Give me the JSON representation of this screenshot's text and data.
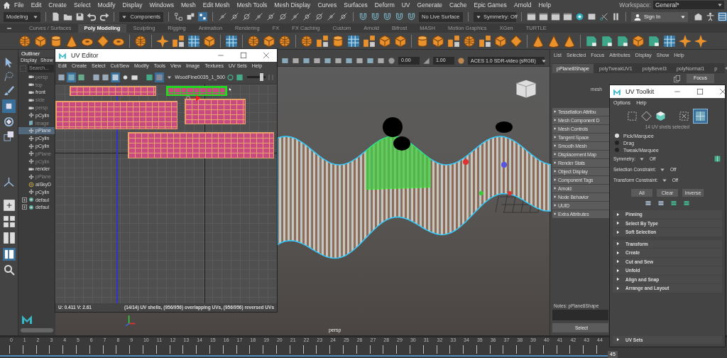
{
  "menu_bar": {
    "items": [
      "File",
      "Edit",
      "Create",
      "Select",
      "Modify",
      "Display",
      "Windows",
      "Mesh",
      "Edit Mesh",
      "Mesh Tools",
      "Mesh Display",
      "Curves",
      "Surfaces",
      "Deform",
      "UV",
      "Generate",
      "Cache",
      "Epic Games",
      "Arnold",
      "Help"
    ],
    "workspace_label": "Workspace:",
    "workspace_value": "General*"
  },
  "status_line": {
    "menu_set": "Modeling",
    "selection_mode": "Components",
    "live_surface": "No Live Surface",
    "symmetry": "Symmetry: Off",
    "sign_in": "Sign In"
  },
  "shelf": {
    "tabs": [
      {
        "label": "Curves / Surfaces",
        "selected": false
      },
      {
        "label": "Poly Modeling",
        "selected": true
      },
      {
        "label": "Sculpting",
        "selected": false
      },
      {
        "label": "Rigging",
        "selected": false
      },
      {
        "label": "Animation",
        "selected": false
      },
      {
        "label": "Rendering",
        "selected": false
      },
      {
        "label": "FX",
        "selected": false
      },
      {
        "label": "FX Caching",
        "selected": false
      },
      {
        "label": "Custom",
        "selected": false
      },
      {
        "label": "Arnold",
        "selected": false
      },
      {
        "label": "Bifrost",
        "selected": false
      },
      {
        "label": "MASH",
        "selected": false
      },
      {
        "label": "Motion Graphics",
        "selected": false
      },
      {
        "label": "XGen",
        "selected": false
      },
      {
        "label": "TURTLE",
        "selected": false
      }
    ]
  },
  "outliner": {
    "title": "Outliner",
    "menu": [
      "Display",
      "Show"
    ],
    "search_placeholder": "Search...",
    "items": [
      {
        "label": "persp",
        "kind": "camera",
        "dim": true,
        "selected": false
      },
      {
        "label": "top",
        "kind": "camera",
        "dim": true,
        "selected": false
      },
      {
        "label": "front",
        "kind": "camera",
        "dim": false,
        "selected": false
      },
      {
        "label": "side",
        "kind": "camera",
        "dim": true,
        "selected": false
      },
      {
        "label": "persp",
        "kind": "camera",
        "dim": true,
        "selected": false
      },
      {
        "label": "pCylin",
        "kind": "mesh",
        "dim": false,
        "selected": false
      },
      {
        "label": "image",
        "kind": "image",
        "dim": true,
        "selected": false
      },
      {
        "label": "pPlane",
        "kind": "mesh",
        "dim": false,
        "selected": true
      },
      {
        "label": "pCylin",
        "kind": "mesh",
        "dim": false,
        "selected": false
      },
      {
        "label": "pCylin",
        "kind": "mesh",
        "dim": false,
        "selected": false
      },
      {
        "label": "pPlane",
        "kind": "mesh",
        "dim": true,
        "selected": false
      },
      {
        "label": "pCylin",
        "kind": "mesh",
        "dim": true,
        "selected": false
      },
      {
        "label": "render",
        "kind": "camera",
        "dim": false,
        "selected": false
      },
      {
        "label": "pPlane",
        "kind": "mesh",
        "dim": true,
        "selected": false
      },
      {
        "label": "aiSkyD",
        "kind": "light",
        "dim": false,
        "selected": false
      },
      {
        "label": "pCylin",
        "kind": "mesh",
        "dim": false,
        "selected": false
      },
      {
        "label": "defaul",
        "kind": "set",
        "dim": false,
        "selected": false
      },
      {
        "label": "defaul",
        "kind": "set",
        "dim": false,
        "selected": false
      }
    ]
  },
  "viewport": {
    "exposure": "0.00",
    "gamma": "1.00",
    "color_space": "ACES 1.0 SDR-video (sRGB)",
    "camera_label": "persp"
  },
  "uv_editor": {
    "title": "UV Editor",
    "menu": [
      "Edit",
      "Create",
      "Select",
      "Cut/Sew",
      "Modify",
      "Tools",
      "View",
      "Image",
      "Textures",
      "UV Sets",
      "Help"
    ],
    "texture": "WoodFine0035_1_500",
    "shells": [
      {
        "selected": false
      },
      {
        "selected": true
      },
      {
        "selected": false
      },
      {
        "selected": false
      },
      {
        "selected": false
      }
    ],
    "coords": "U: 0.411 V: 2.61",
    "status": "(14/14) UV shells, (956/956) overlapping UVs, (956/956) reversed UVs"
  },
  "attribute_editor": {
    "menu": [
      "List",
      "Selected",
      "Focus",
      "Attributes",
      "Display",
      "Show",
      "Help"
    ],
    "tabs": [
      {
        "label": "pPlane8Shape",
        "selected": true
      },
      {
        "label": "polyTweakUV1",
        "selected": false
      },
      {
        "label": "polyBevel3",
        "selected": false
      },
      {
        "label": "polyNormal1",
        "selected": false
      },
      {
        "label": "p",
        "selected": false
      }
    ],
    "focus_button": "Focus",
    "mesh_label": "mesh",
    "sections": [
      "Tessellation Attribu",
      "Mesh Component D",
      "Mesh Controls",
      "Tangent Space",
      "Smooth Mesh",
      "Displacement Map",
      "Render Stats",
      "Object Display",
      "Component Tags",
      "Arnold",
      "Node Behavior",
      "UUID",
      "Extra Attributes"
    ],
    "notes_label": "Notes:  pPlane8Shape",
    "select_button": "Select"
  },
  "uv_toolkit": {
    "title": "UV Toolkit",
    "menu": [
      "Options",
      "Help"
    ],
    "selection_info": "14 UV shells selected",
    "modes": [
      {
        "label": "Pick/Marquee",
        "selected": true
      },
      {
        "label": "Drag",
        "selected": false
      },
      {
        "label": "Tweak/Marquee",
        "selected": false
      }
    ],
    "constraints": [
      {
        "label": "Symmetry:",
        "value": "Off"
      },
      {
        "label": "Selection Constraint:",
        "value": "Off"
      },
      {
        "label": "Transform Constraint:",
        "value": "Off"
      }
    ],
    "buttons": [
      "All",
      "Clear",
      "Inverse"
    ],
    "selection_sections": [
      "Pinning",
      "Select By Type",
      "Soft Selection"
    ],
    "tool_sections": [
      "Transform",
      "Create",
      "Cut and Sew",
      "Unfold",
      "Align and Snap",
      "Arrange and Layout"
    ],
    "footer_section": "UV Sets"
  },
  "timeline": {
    "ticks": [
      "0",
      "1",
      "2",
      "3",
      "4",
      "5",
      "6",
      "7",
      "8",
      "9",
      "10",
      "11",
      "12",
      "13",
      "14",
      "15",
      "16",
      "17",
      "18",
      "19",
      "20",
      "21",
      "22",
      "23",
      "24",
      "25",
      "26",
      "27",
      "28",
      "29",
      "30",
      "31",
      "32",
      "33",
      "34",
      "35",
      "36",
      "37",
      "38",
      "39",
      "40",
      "41",
      "42",
      "43",
      "44"
    ],
    "current_frame": "45"
  }
}
